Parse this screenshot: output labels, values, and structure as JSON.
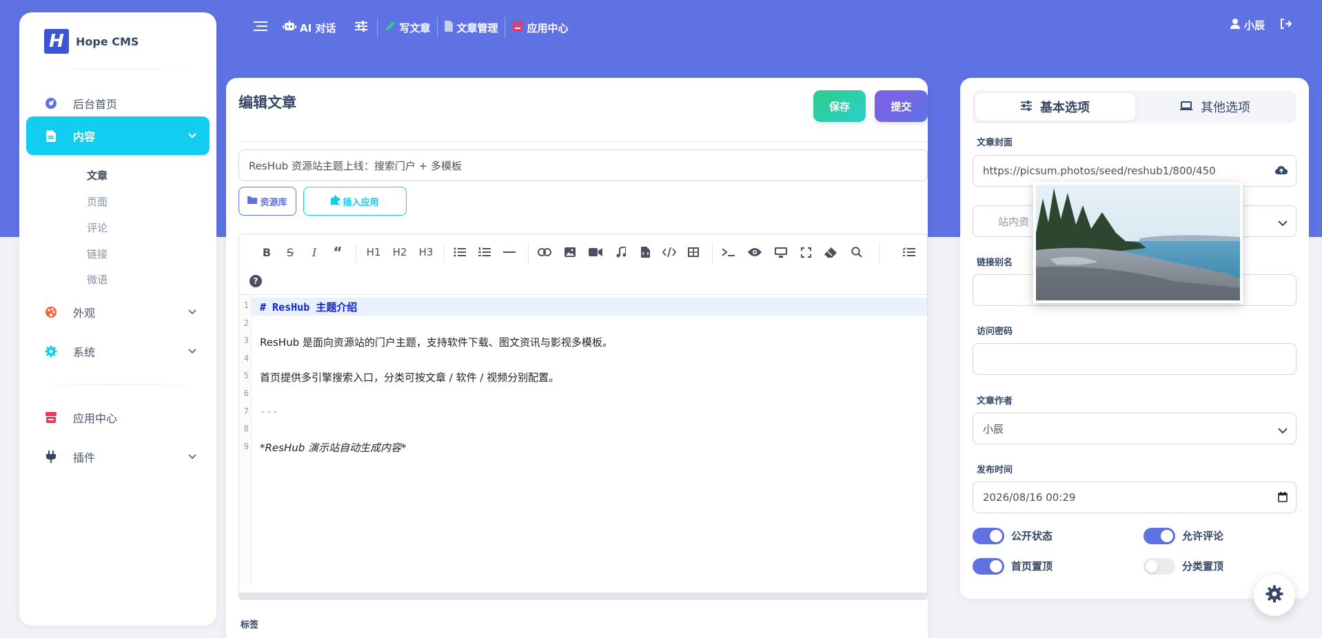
{
  "brand": {
    "logo_letter": "H",
    "name": "Hope CMS"
  },
  "sidebar": {
    "items": [
      {
        "label": "后台首页"
      },
      {
        "label": "内容"
      },
      {
        "label": "外观"
      },
      {
        "label": "系统"
      },
      {
        "label": "应用中心"
      },
      {
        "label": "插件"
      }
    ],
    "content_sub": [
      "文章",
      "页面",
      "评论",
      "链接",
      "微语"
    ]
  },
  "topnav": {
    "items": [
      "AI 对话",
      "写文章",
      "文章管理",
      "应用中心"
    ],
    "username": "小辰"
  },
  "editor": {
    "page_title": "编辑文章",
    "save_label": "保存",
    "submit_label": "提交",
    "title_value": "ResHub 资源站主题上线：搜索门户 + 多模板",
    "library_label": "资源库",
    "insert_app_label": "插入应用",
    "toolbar_text": {
      "h1": "H1",
      "h2": "H2",
      "h3": "H3",
      "help": "?"
    },
    "lines": [
      "# ResHub 主题介绍",
      "",
      "ResHub 是面向资源站的门户主题，支持软件下载、图文资讯与影视多模板。",
      "",
      "首页提供多引擎搜索入口，分类可按文章 / 软件 / 视频分别配置。",
      "",
      "---",
      "",
      "*ResHub 演示站自动生成内容*"
    ],
    "line_numbers": [
      "1",
      "2",
      "3",
      "4",
      "5",
      "6",
      "7",
      "8",
      "9"
    ],
    "tags_label": "标签"
  },
  "options": {
    "tab_basic": "基本选项",
    "tab_other": "其他选项",
    "cover_label": "文章封面",
    "cover_value": "https://picsum.photos/seed/reshub1/800/450",
    "category_placeholder": "站内资",
    "alias_label": "链接别名",
    "password_label": "访问密码",
    "author_label": "文章作者",
    "author_value": "小辰",
    "publish_label": "发布时间",
    "publish_value": "2026/08/16 00:29",
    "toggles": [
      {
        "label": "公开状态",
        "on": true
      },
      {
        "label": "允许评论",
        "on": true
      },
      {
        "label": "首页置顶",
        "on": true
      },
      {
        "label": "分类置顶",
        "on": false
      }
    ]
  },
  "colors": {
    "primary": "#5e72e4",
    "info": "#11cdef",
    "success": "#2dce89",
    "heading": "#344767"
  }
}
